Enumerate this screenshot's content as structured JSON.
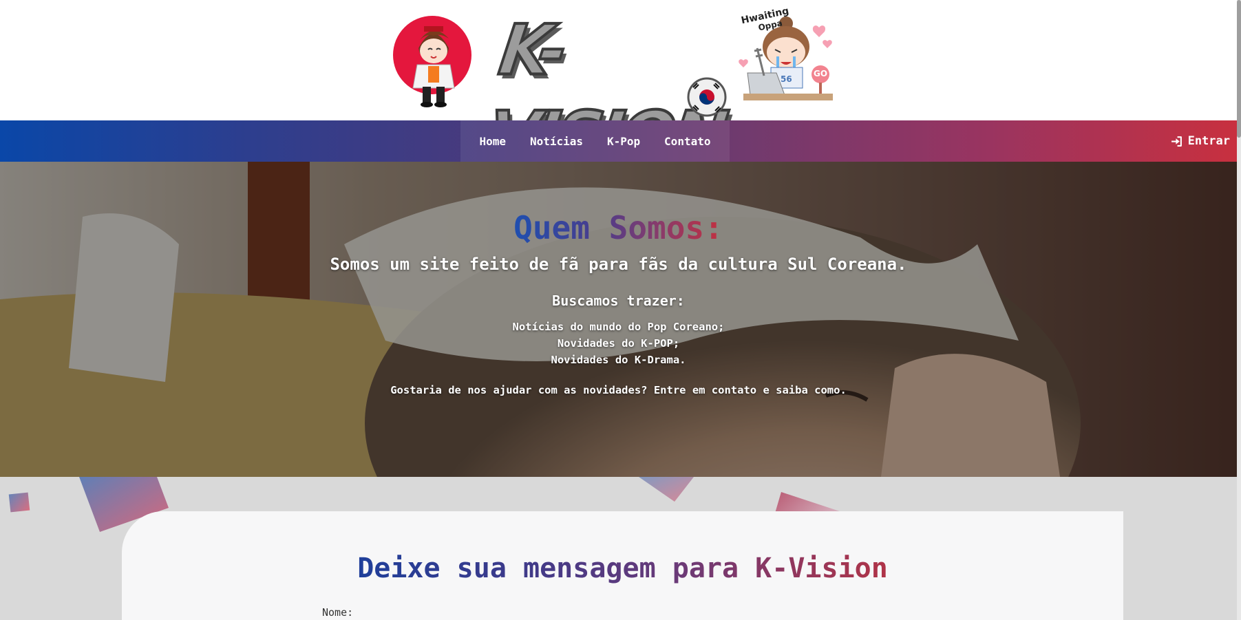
{
  "header": {
    "logo_text": "K-VISION",
    "sticker_text_line1": "Hwaiting",
    "sticker_text_line2": "Oppa",
    "sticker_badge": "GO",
    "sticker_jersey": "56"
  },
  "nav": {
    "items": [
      "Home",
      "Notícias",
      "K-Pop",
      "Contato"
    ],
    "login_label": "Entrar"
  },
  "hero": {
    "title": "Quem Somos:",
    "subtitle": "Somos um site feito de fã para fãs da cultura Sul Coreana.",
    "heading": "Buscamos trazer:",
    "list": [
      "Notícias do mundo do Pop Coreano;",
      "Novidades do K-POP;",
      "Novidades do K-Drama."
    ],
    "paragraph": "Gostaria de nos ajudar com as novidades? Entre em contato e saiba como."
  },
  "contact": {
    "title": "Deixe sua mensagem para K-Vision",
    "name_label": "Nome:"
  },
  "colors": {
    "brand_blue": "#0a47a8",
    "brand_red": "#c8303f",
    "contact_bg": "#d9d9d9",
    "card_bg": "#f7f7f8"
  }
}
